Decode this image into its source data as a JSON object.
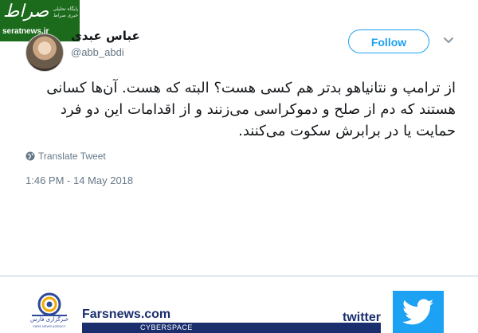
{
  "watermark": {
    "mark": "صراط",
    "subtitle": "پایگاه تحلیلی خبری صراط",
    "site": "seratnews.ir"
  },
  "tweet": {
    "display_name": "عباس عبدی",
    "handle": "@abb_abdi",
    "follow_label": "Follow",
    "text": "از ترامپ و نتانیاهو بدتر هم کسی هست؟ البته که هست. آن‌ها کسانی هستند که دم از صلح و دموکراسی می‌زنند و از اقدامات این دو فرد حمایت یا در برابرش سکوت می‌کنند.",
    "translate_label": "Translate Tweet",
    "timestamp": "1:46 PM - 14 May 2018"
  },
  "footer": {
    "logo_text": "خبرگزاری فارس",
    "logo_subtext": "FARS NEWS AGENCY",
    "site": "Farsnews.com",
    "section": "CYBERSPACE",
    "twitter_word": "twitter"
  },
  "colors": {
    "twitter_blue": "#1da1f2",
    "fars_navy": "#1a2e6e",
    "watermark_green": "#1c6b1c",
    "secondary_text": "#657786"
  },
  "icons": [
    "avatar",
    "chevron-down-icon",
    "globe-icon",
    "fars-logo",
    "twitter-bird-icon"
  ]
}
